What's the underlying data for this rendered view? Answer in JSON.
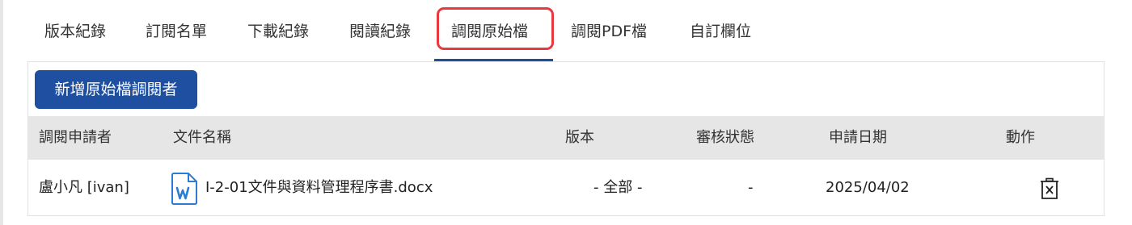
{
  "tabs": [
    {
      "label": "版本紀錄"
    },
    {
      "label": "訂閱名單"
    },
    {
      "label": "下載紀錄"
    },
    {
      "label": "閱讀紀錄"
    },
    {
      "label": "調閱原始檔"
    },
    {
      "label": "調閱PDF檔"
    },
    {
      "label": "自訂欄位"
    }
  ],
  "active_tab": "調閱原始檔",
  "add_button_label": "新增原始檔調閱者",
  "table": {
    "headers": [
      "調閱申請者",
      "文件名稱",
      "版本",
      "審核狀態",
      "申請日期",
      "動作"
    ],
    "rows": [
      {
        "applicant": "盧小凡 [ivan]",
        "file_name": "I-2-01文件與資料管理程序書.docx",
        "version": "- 全部 -",
        "review_status": "-",
        "date": "2025/04/02",
        "file_icon": "word-document-icon",
        "action_icon": "delete-icon"
      }
    ]
  },
  "colors": {
    "accent": "#1f4fa0",
    "highlight": "#e8393e",
    "header_bg": "#e6e6e6",
    "word_icon": "#2b7cd3"
  }
}
